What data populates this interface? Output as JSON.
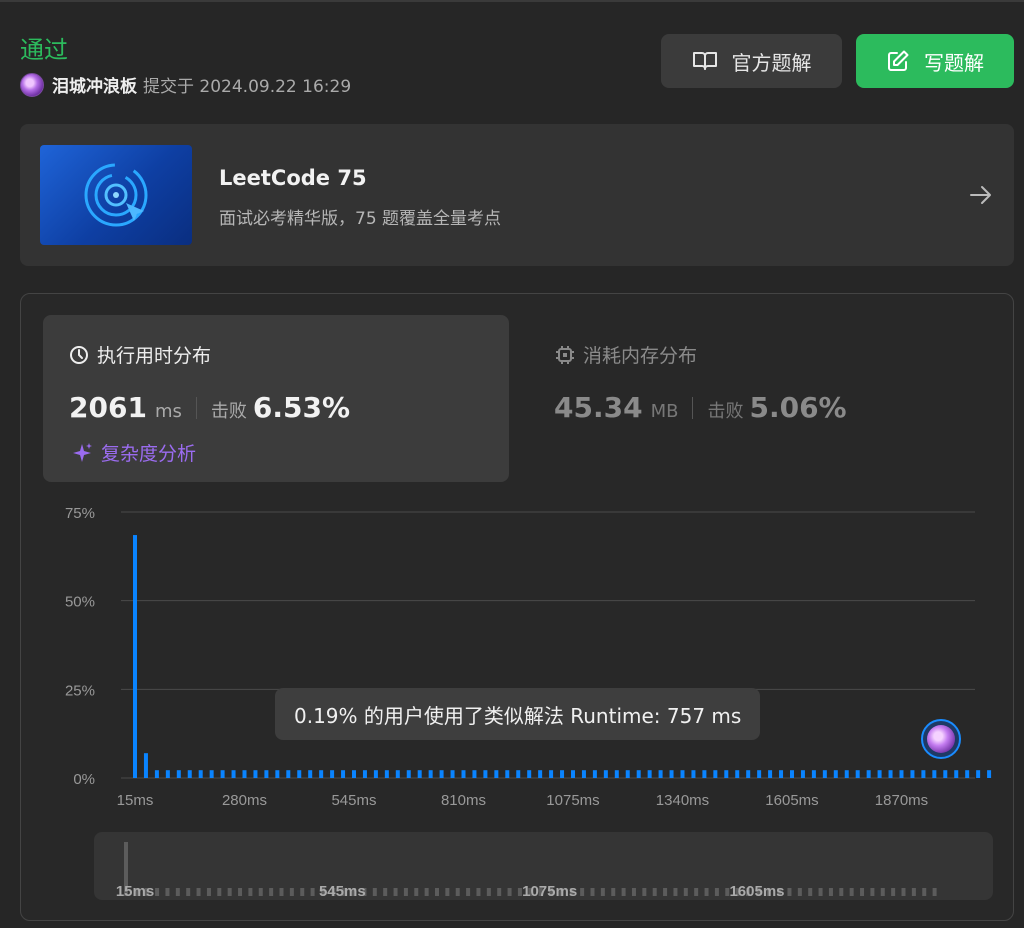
{
  "submission": {
    "status": "通过",
    "username": "泪城冲浪板",
    "submitted_text": "提交于 2024.09.22 16:29"
  },
  "header": {
    "official_solution_label": "官方题解",
    "write_solution_label": "写题解"
  },
  "promo": {
    "title": "LeetCode 75",
    "subtitle": "面试必考精华版，75 题覆盖全量考点"
  },
  "runtime": {
    "title": "执行用时分布",
    "value": "2061",
    "unit": "ms",
    "beats_label": "击败",
    "beats_value": "6.53%",
    "complexity_label": "复杂度分析"
  },
  "memory": {
    "title": "消耗内存分布",
    "value": "45.34",
    "unit": "MB",
    "beats_label": "击败",
    "beats_value": "5.06%"
  },
  "tooltip": {
    "text": "0.19% 的用户使用了类似解法 Runtime: 757 ms"
  },
  "colors": {
    "accepted_green": "#2cbb5d",
    "bar_blue": "#0a84ff",
    "complexity_purple": "#9b6cf0",
    "panel_bg": "#282828"
  },
  "chart_data": {
    "type": "bar",
    "title": "",
    "xlabel": "",
    "ylabel": "",
    "ylim": [
      0,
      75
    ],
    "y_ticks": [
      "75%",
      "50%",
      "25%",
      "0%"
    ],
    "x_ticks": [
      "15ms",
      "280ms",
      "545ms",
      "810ms",
      "1075ms",
      "1340ms",
      "1605ms",
      "1870ms"
    ],
    "x_range_ms": [
      15,
      2100
    ],
    "bar_width_ms": 26.5,
    "bar_count": 79,
    "values": [
      68.5,
      7,
      2.2,
      2.2,
      2.2,
      2.2,
      2.2,
      2.2,
      2.2,
      2.2,
      2.2,
      2.2,
      2.2,
      2.2,
      2.2,
      2.2,
      2.2,
      2.2,
      2.2,
      2.2,
      2.2,
      2.2,
      2.2,
      2.2,
      2.2,
      2.2,
      2.2,
      2.2,
      2.2,
      2.2,
      2.2,
      2.2,
      2.2,
      2.2,
      2.2,
      2.2,
      2.2,
      2.2,
      2.2,
      2.2,
      2.2,
      2.2,
      2.2,
      2.2,
      2.2,
      2.2,
      2.2,
      2.2,
      2.2,
      2.2,
      2.2,
      2.2,
      2.2,
      2.2,
      2.2,
      2.2,
      2.2,
      2.2,
      2.2,
      2.2,
      2.2,
      2.2,
      2.2,
      2.2,
      2.2,
      2.2,
      2.2,
      2.2,
      2.2,
      2.2,
      2.2,
      2.2,
      2.2,
      2.2,
      2.2,
      2.2,
      2.2,
      2.2,
      2.2
    ],
    "user_runtime_ms": 2061,
    "grid": true,
    "scrubber": {
      "x_ticks": [
        "15ms",
        "545ms",
        "1075ms",
        "1605ms"
      ]
    }
  }
}
